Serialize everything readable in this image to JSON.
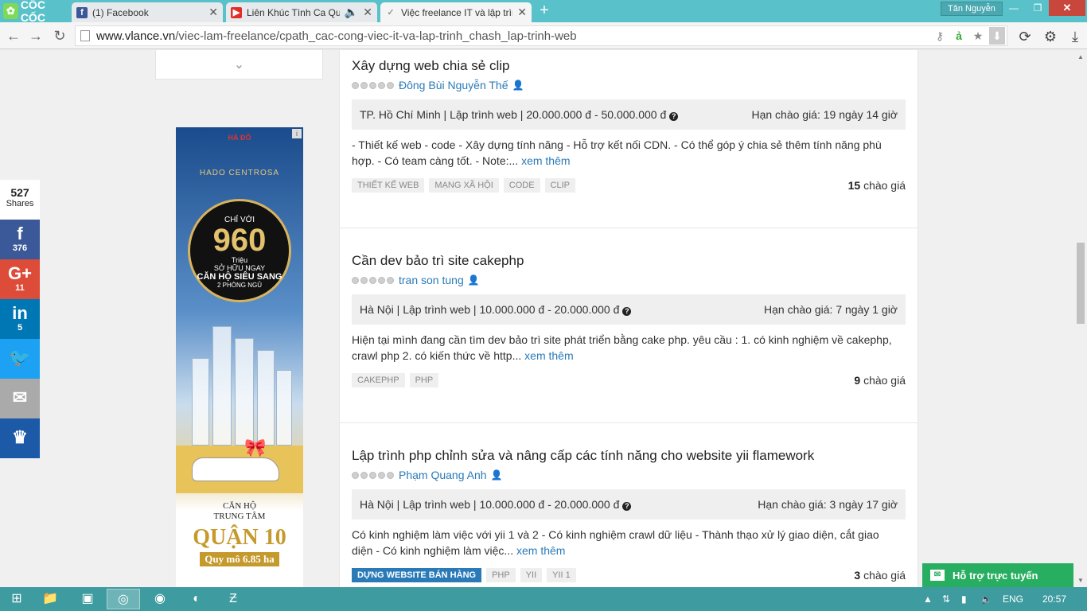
{
  "browser": {
    "brand": "CỐC CỐC",
    "tabs": [
      {
        "label": "(1) Facebook",
        "icon": "facebook-icon"
      },
      {
        "label": "Liên Khúc Tình Ca Quê",
        "icon": "youtube-icon"
      },
      {
        "label": "Việc freelance IT và lập trìn",
        "icon": "vlance-icon"
      }
    ],
    "user": "Tân Nguyễn",
    "url_host": "www.vlance.vn",
    "url_path": "/viec-lam-freelance/cpath_cac-cong-viec-it-va-lap-trinh_chash_lap-trinh-web"
  },
  "share": {
    "count": "527",
    "count_label": "Shares",
    "buttons": [
      {
        "name": "facebook",
        "icon": "f",
        "count": "376",
        "color": "#3b5998"
      },
      {
        "name": "google-plus",
        "icon": "G+",
        "count": "11",
        "color": "#dd4b39"
      },
      {
        "name": "linkedin",
        "icon": "in",
        "count": "5",
        "color": "#0077b5"
      },
      {
        "name": "twitter",
        "icon": "🐦",
        "count": "",
        "color": "#1da1f2"
      },
      {
        "name": "email",
        "icon": "✉",
        "count": "",
        "color": "#aaaaaa"
      },
      {
        "name": "sumome",
        "icon": "♛",
        "count": "",
        "color": "#1c5aa8"
      }
    ]
  },
  "ad": {
    "top_brand": "HÀ ĐÔ",
    "project": "HADO CENTROSA",
    "promo_line1": "CHỈ VỚI",
    "promo_price": "960",
    "promo_unit": "Triệu",
    "promo_line2": "SỞ HỮU NGAY",
    "promo_line3": "CĂN HỘ SIÊU SANG",
    "promo_line4": "2 PHÒNG NGỦ",
    "bottom_line1": "CĂN HỘ",
    "bottom_line2": "TRUNG TÂM",
    "district": "QUẬN 10",
    "scale": "Quy mô 6.85 ha"
  },
  "jobs": [
    {
      "title": "Xây dựng web chia sẻ clip",
      "author": "Đông Bùi Nguyễn Thế",
      "location": "TP. Hồ Chí Minh | Lập trình web | 20.000.000 đ - 50.000.000 đ",
      "deadline": "Hạn chào giá: 19 ngày 14 giờ",
      "desc": "- Thiết kế web - code - Xây dựng tính năng - Hỗ trợ kết nối CDN. - Có thể góp ý chia sẻ thêm tính năng phù hợp. - Có team càng tốt. - Note:...",
      "more": "xem thêm",
      "tags": [
        "THIẾT KẾ WEB",
        "MẠNG XÃ HỘI",
        "CODE",
        "CLIP"
      ],
      "bids": "15",
      "bids_label": "chào giá"
    },
    {
      "title": "Cần dev bảo trì site cakephp",
      "author": "tran son tung",
      "location": "Hà Nội | Lập trình web | 10.000.000 đ - 20.000.000 đ",
      "deadline": "Hạn chào giá: 7 ngày 1 giờ",
      "desc": "Hiện tại mình đang cần tìm dev bảo trì site phát triển bằng cake php. yêu cầu : 1. có kinh nghiệm về cakephp, crawl php 2. có kiến thức về http...",
      "more": "xem thêm",
      "tags": [
        "CAKEPHP",
        "PHP"
      ],
      "bids": "9",
      "bids_label": "chào giá"
    },
    {
      "title": "Lập trình php chỉnh sửa và nâng cấp các tính năng cho website yii flamework",
      "author": "Phạm Quang Anh",
      "location": "Hà Nội | Lập trình web | 10.000.000 đ - 20.000.000 đ",
      "deadline": "Hạn chào giá: 3 ngày 17 giờ",
      "desc": "Có kinh nghiệm làm việc với yii 1 và 2 - Có kinh nghiệm crawl dữ liệu - Thành thạo xử lý giao diện, cắt giao diện - Có kinh nghiệm làm việc...",
      "more": "xem thêm",
      "tags": [
        "DỰNG WEBSITE BÁN HÀNG",
        "PHP",
        "YII",
        "YII 1"
      ],
      "bids": "3",
      "bids_label": "chào giá"
    }
  ],
  "chat": {
    "label": "Hỗ trợ trực tuyến"
  },
  "taskbar": {
    "language": "ENG",
    "time": "20:57"
  }
}
